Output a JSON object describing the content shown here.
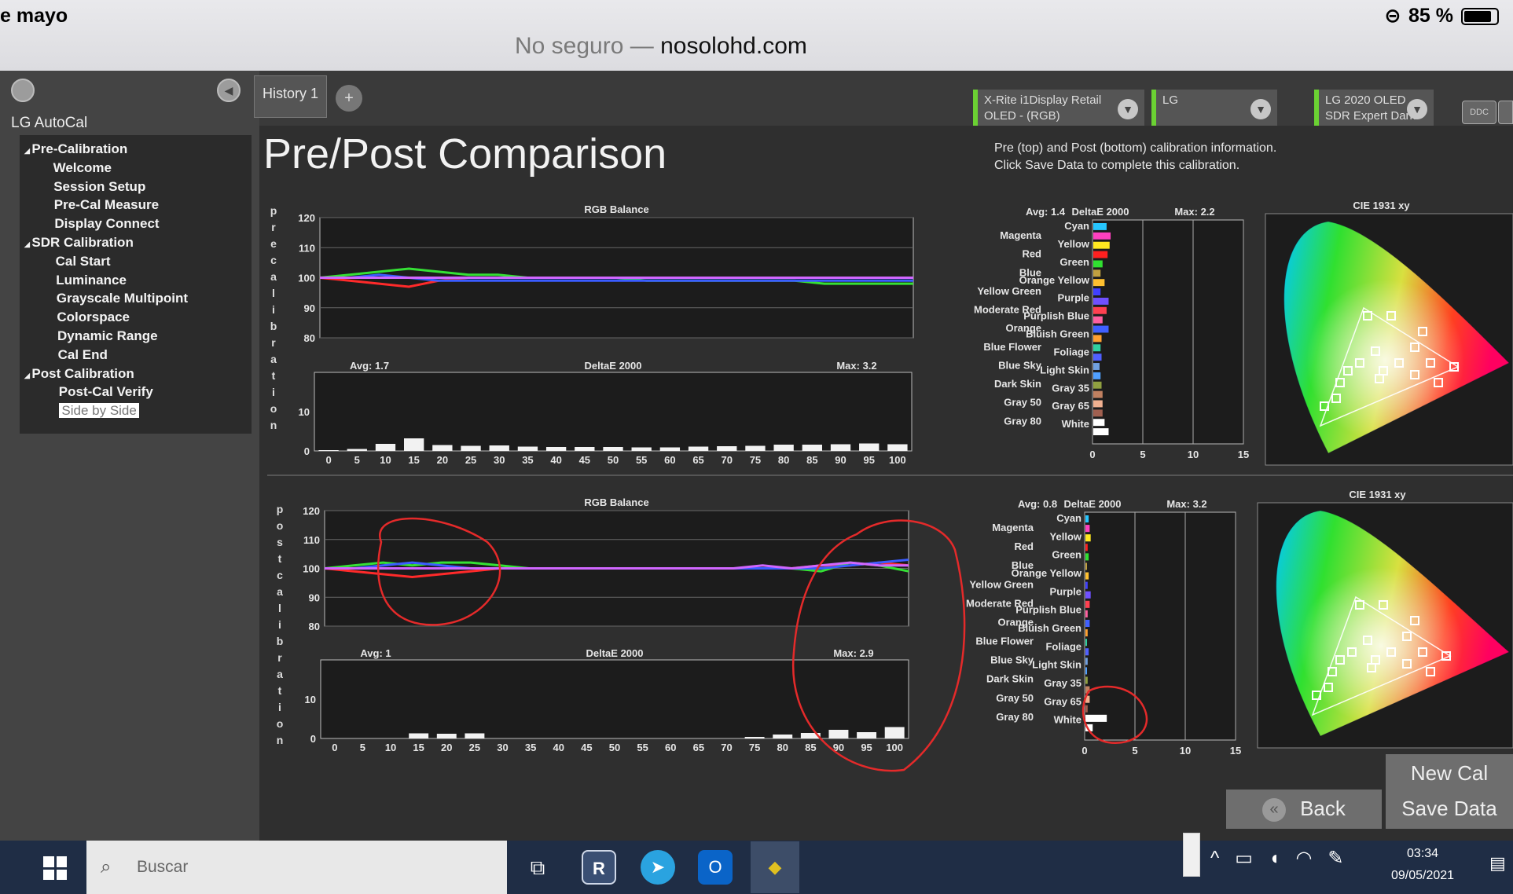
{
  "ios": {
    "time": "e mayo",
    "battery": "85 %",
    "url_prefix": "No seguro —",
    "url_domain": "nosolohd.com"
  },
  "app": {
    "title": "LG AutoCal"
  },
  "nav": [
    {
      "label": "Pre-Calibration",
      "level": 0,
      "expander": "◢"
    },
    {
      "label": "Welcome",
      "level": 1
    },
    {
      "label": "Session Setup",
      "level": 1
    },
    {
      "label": "Pre-Cal Measure",
      "level": 1
    },
    {
      "label": "Display  Connect",
      "level": 1
    },
    {
      "label": "SDR Calibration",
      "level": 0,
      "expander": "◢"
    },
    {
      "label": "Cal Start",
      "level": 1
    },
    {
      "label": "Luminance",
      "level": 1
    },
    {
      "label": "Grayscale Multipoint",
      "level": 1
    },
    {
      "label": "Colorspace",
      "level": 1
    },
    {
      "label": "Dynamic Range",
      "level": 1
    },
    {
      "label": "Cal End",
      "level": 1
    },
    {
      "label": "Post Calibration",
      "level": 0,
      "expander": "◢"
    },
    {
      "label": "Post-Cal Verify",
      "level": 1
    },
    {
      "label": "Side by Side",
      "level": 1,
      "selected": true
    }
  ],
  "tabs": {
    "history": "History 1",
    "add": "+"
  },
  "selectors": [
    {
      "line1": "X-Rite i1Display Retail",
      "line2": "OLED - (RGB)"
    },
    {
      "line1": "LG",
      "line2": ""
    },
    {
      "line1": "LG 2020 OLED",
      "line2": "SDR Expert Dark"
    }
  ],
  "ddc": "DDC",
  "page": {
    "title": "Pre/Post Comparison",
    "instructions_1": "Pre (top) and Post (bottom) calibration information.",
    "instructions_2": "Click Save Data to complete this calibration."
  },
  "vertical_labels": {
    "pre": "precalibration",
    "post": "postcalibration"
  },
  "buttons": {
    "new_cal": "New Cal",
    "back": "Back",
    "back_icon": "«",
    "save": "Save Data"
  },
  "taskbar": {
    "search": "Buscar",
    "time": "03:34",
    "date": "09/05/2021"
  },
  "chart_data": [
    {
      "type": "line",
      "title": "RGB Balance",
      "panel": "pre",
      "x": [
        0,
        5,
        10,
        15,
        20,
        25,
        30,
        35,
        40,
        45,
        50,
        55,
        60,
        65,
        70,
        75,
        80,
        85,
        90,
        95,
        100
      ],
      "ylim": [
        80,
        120
      ],
      "yticks": [
        80,
        90,
        100,
        110,
        120
      ],
      "series": [
        {
          "color": "#ff2a2a",
          "values": [
            100,
            99,
            98,
            97,
            99,
            100,
            100,
            100,
            100,
            100,
            100,
            100,
            100,
            100,
            100,
            100,
            100,
            100,
            100,
            100,
            100
          ]
        },
        {
          "color": "#35e035",
          "values": [
            100,
            101,
            102,
            103,
            102,
            101,
            101,
            100,
            100,
            100,
            100,
            99,
            99,
            99,
            99,
            99,
            99,
            98,
            98,
            98,
            98
          ]
        },
        {
          "color": "#3a5cff",
          "values": [
            100,
            100,
            101,
            100,
            99,
            99,
            99,
            99,
            99,
            99,
            99,
            99,
            99,
            99,
            99,
            99,
            99,
            99,
            99,
            99,
            99
          ]
        },
        {
          "color": "#d066ff",
          "values": [
            100,
            100,
            100,
            100,
            100,
            100,
            100,
            100,
            100,
            100,
            100,
            100,
            100,
            100,
            100,
            100,
            100,
            100,
            100,
            100,
            100
          ]
        }
      ]
    },
    {
      "type": "bar",
      "title": "DeltaE 2000",
      "panel": "pre",
      "avg": "Avg: 1.7",
      "max": "Max: 3.2",
      "categories": [
        "0",
        "5",
        "10",
        "15",
        "20",
        "25",
        "30",
        "35",
        "40",
        "45",
        "50",
        "55",
        "60",
        "65",
        "70",
        "75",
        "80",
        "85",
        "90",
        "95",
        "100"
      ],
      "values": [
        0.2,
        0.5,
        1.8,
        3.2,
        1.5,
        1.3,
        1.4,
        1.1,
        1.0,
        1.0,
        1.0,
        0.9,
        0.9,
        1.1,
        1.2,
        1.3,
        1.6,
        1.6,
        1.7,
        1.9,
        1.7
      ],
      "ylim": [
        0,
        20
      ],
      "yticks": [
        0,
        10
      ]
    },
    {
      "type": "bar",
      "title": "DeltaE 2000",
      "panel": "pre-colors",
      "avg": "Avg: 1.4",
      "max": "Max: 2.2",
      "left_labels": [
        "Magenta",
        "Red",
        "Blue",
        "Yellow Green",
        "Moderate Red",
        "Orange",
        "Blue Flower",
        "Blue Sky",
        "Dark Skin",
        "Gray 50",
        "Gray 80"
      ],
      "right_labels": [
        "Cyan",
        "Yellow",
        "Green",
        "Orange Yellow",
        "Purple",
        "Purplish Blue",
        "Bluish Green",
        "Foliage",
        "Light Skin",
        "Gray 35",
        "Gray 65",
        "White"
      ],
      "values": [
        1.4,
        1.8,
        1.7,
        1.5,
        1.0,
        0.8,
        1.2,
        0.8,
        1.6,
        1.4,
        1.0,
        1.6,
        0.9,
        0.8,
        0.9,
        0.7,
        0.8,
        0.9,
        1.0,
        1.0,
        1.0,
        1.2,
        1.6,
        1.9,
        2.0,
        1.9
      ],
      "colors": [
        "#26c6ff",
        "#ff40c0",
        "#ffe820",
        "#ff2020",
        "#30e030",
        "#c0a040",
        "#ffc030",
        "#4040ff",
        "#7050ff",
        "#ff4050",
        "#ff60a0",
        "#4060ff",
        "#ffa030",
        "#30d0a0",
        "#5060ff",
        "#70a0e0",
        "#50a0ff",
        "#90a040",
        "#c08060",
        "#f0b090",
        "#a06050",
        "#ffffff",
        "#ffffff",
        "#ffffff",
        "#ffffff",
        "#ffffff"
      ],
      "xlim": [
        0,
        15
      ],
      "xticks": [
        0,
        5,
        10,
        15
      ]
    },
    {
      "type": "scatter",
      "title": "CIE 1931 xy",
      "panel": "pre"
    },
    {
      "type": "line",
      "title": "RGB Balance",
      "panel": "post",
      "x": [
        0,
        5,
        10,
        15,
        20,
        25,
        30,
        35,
        40,
        45,
        50,
        55,
        60,
        65,
        70,
        75,
        80,
        85,
        90,
        95,
        100
      ],
      "ylim": [
        80,
        120
      ],
      "yticks": [
        80,
        90,
        100,
        110,
        120
      ],
      "series": [
        {
          "color": "#ff2a2a",
          "values": [
            100,
            99,
            98,
            97,
            98,
            99,
            100,
            100,
            100,
            100,
            100,
            100,
            100,
            100,
            100,
            100,
            100,
            101,
            101,
            102,
            101
          ]
        },
        {
          "color": "#35e035",
          "values": [
            100,
            101,
            102,
            101,
            102,
            102,
            101,
            100,
            100,
            100,
            100,
            100,
            100,
            100,
            100,
            100,
            100,
            99,
            102,
            101,
            99
          ]
        },
        {
          "color": "#3a5cff",
          "values": [
            100,
            100,
            101,
            102,
            101,
            100,
            100,
            100,
            100,
            100,
            100,
            100,
            100,
            100,
            100,
            100,
            100,
            100,
            101,
            102,
            103
          ]
        },
        {
          "color": "#d066ff",
          "values": [
            100,
            100,
            100,
            100,
            100,
            100,
            100,
            100,
            100,
            100,
            100,
            100,
            100,
            100,
            100,
            101,
            100,
            101,
            102,
            101,
            101
          ]
        }
      ]
    },
    {
      "type": "bar",
      "title": "DeltaE 2000",
      "panel": "post",
      "avg": "Avg: 1",
      "max": "Max: 2.9",
      "categories": [
        "0",
        "5",
        "10",
        "15",
        "20",
        "25",
        "30",
        "35",
        "40",
        "45",
        "50",
        "55",
        "60",
        "65",
        "70",
        "75",
        "80",
        "85",
        "90",
        "95",
        "100"
      ],
      "values": [
        0,
        0,
        0,
        1.3,
        1.2,
        1.3,
        0,
        0,
        0,
        0,
        0,
        0,
        0,
        0,
        0,
        0.4,
        1.0,
        1.4,
        2.2,
        1.6,
        2.9
      ],
      "ylim": [
        0,
        20
      ],
      "yticks": [
        0,
        10
      ]
    },
    {
      "type": "bar",
      "title": "DeltaE 2000",
      "panel": "post-colors",
      "avg": "Avg: 0.8",
      "max": "Max: 3.2",
      "left_labels": [
        "Magenta",
        "Red",
        "Blue",
        "Yellow Green",
        "Moderate Red",
        "Orange",
        "Blue Flower",
        "Blue Sky",
        "Dark Skin",
        "Gray 50",
        "Gray 80"
      ],
      "right_labels": [
        "Cyan",
        "Yellow",
        "Green",
        "Orange Yellow",
        "Purple",
        "Purplish Blue",
        "Bluish Green",
        "Foliage",
        "Light Skin",
        "Gray 35",
        "Gray 65",
        "White"
      ],
      "values": [
        0.4,
        0.5,
        0.6,
        0.3,
        0.4,
        0.2,
        0.4,
        0.3,
        0.6,
        0.5,
        0.3,
        0.5,
        0.3,
        0.2,
        0.4,
        0.3,
        0.2,
        0.3,
        0.5,
        0.5,
        0.3,
        2.2,
        0.8,
        1.6,
        2.4,
        3.2
      ],
      "colors": [
        "#26c6ff",
        "#ff40c0",
        "#ffe820",
        "#ff2020",
        "#30e030",
        "#c0a040",
        "#ffc030",
        "#4040ff",
        "#7050ff",
        "#ff4050",
        "#ff60a0",
        "#4060ff",
        "#ffa030",
        "#30d0a0",
        "#5060ff",
        "#70a0e0",
        "#50a0ff",
        "#90a040",
        "#c08060",
        "#f0b090",
        "#a06050",
        "#ffffff",
        "#ffffff",
        "#ffffff",
        "#ffffff",
        "#ffffff"
      ],
      "xlim": [
        0,
        15
      ],
      "xticks": [
        0,
        5,
        10,
        15
      ]
    },
    {
      "type": "scatter",
      "title": "CIE 1931 xy",
      "panel": "post"
    }
  ]
}
